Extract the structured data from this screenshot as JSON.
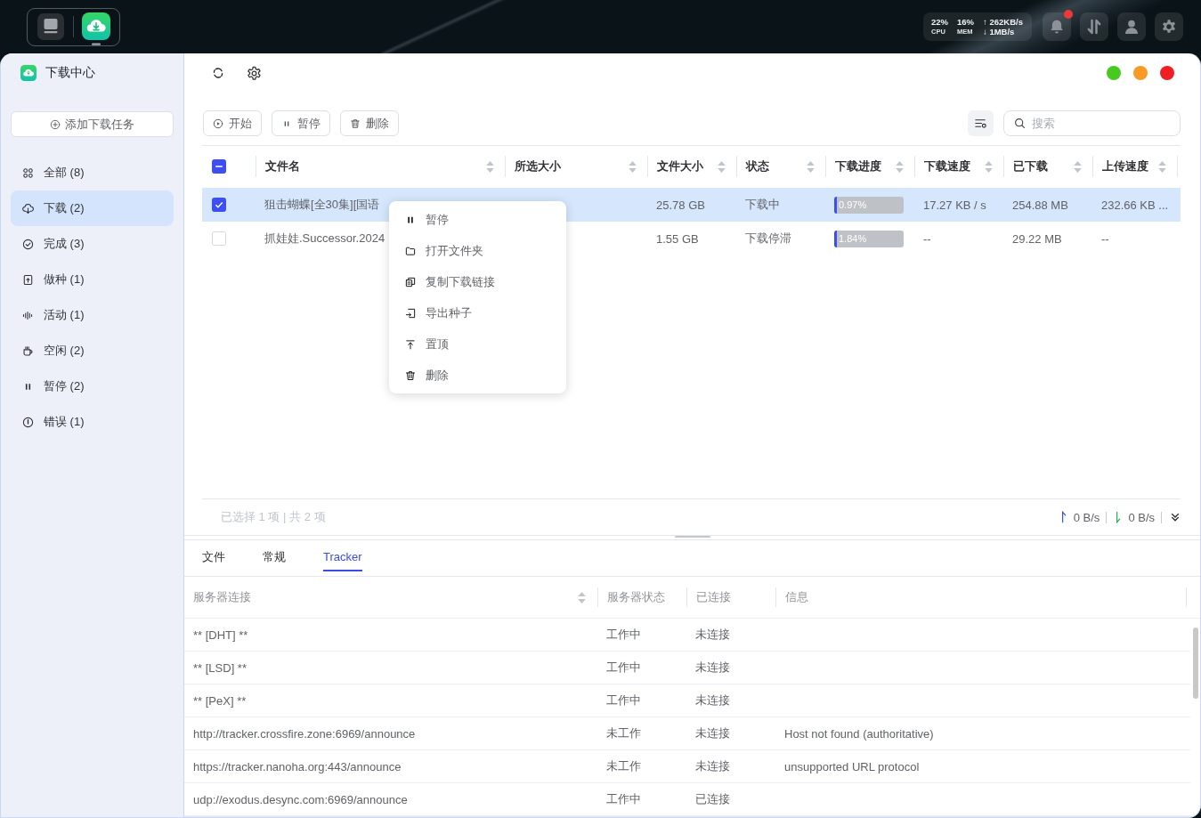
{
  "top_bar": {
    "stats": [
      {
        "value": "22%",
        "label": "CPU"
      },
      {
        "value": "16%",
        "label": "MEM"
      }
    ],
    "upload_rate": "↑ 262KB/s",
    "download_rate": "↓ 1MB/s",
    "notifications": {
      "unread": true
    }
  },
  "sidebar": {
    "title": "下载中心",
    "add_button": "添加下载任务",
    "items": [
      {
        "label": "全部 (8)",
        "selected": false
      },
      {
        "label": "下载 (2)",
        "selected": true
      },
      {
        "label": "完成 (3)",
        "selected": false
      },
      {
        "label": "做种 (1)",
        "selected": false
      },
      {
        "label": "活动 (1)",
        "selected": false
      },
      {
        "label": "空闲 (2)",
        "selected": false
      },
      {
        "label": "暂停 (2)",
        "selected": false
      },
      {
        "label": "错误 (1)",
        "selected": false
      }
    ]
  },
  "toolbar": {
    "actions": [
      "开始",
      "暂停",
      "删除"
    ],
    "search": {
      "placeholder": "搜索"
    }
  },
  "table": {
    "select_all": {
      "checked": false,
      "indeterminate": true
    },
    "columns": [
      "文件名",
      "所选大小",
      "文件大小",
      "状态",
      "下载进度",
      "下载速度",
      "已下载",
      "上传速度"
    ],
    "rows": [
      {
        "selected": true,
        "name": "狙击蝴蝶[全30集][国语",
        "size": "25.78 GB",
        "status": "下载中",
        "level": 0.0097,
        "progress": "0.97%",
        "speed": "17.27 KB / s",
        "downloaded": "254.88 MB",
        "upload_speed": "232.66 KB ..."
      },
      {
        "selected": false,
        "name": "抓娃娃.Successor.2024",
        "size": "1.55 GB",
        "status": "下载停滞",
        "level": 0.0184,
        "progress": "1.84%",
        "speed": "--",
        "downloaded": "29.22 MB",
        "upload_speed": "--"
      }
    ]
  },
  "context_menu": {
    "items": [
      "暂停",
      "打开文件夹",
      "复制下载链接",
      "导出种子",
      "置顶",
      "删除"
    ]
  },
  "footer": {
    "selection": "已选择 1 项 | 共 2 项",
    "upload_rate": "0 B/s",
    "download_rate": "0 B/s"
  },
  "detail_tabs": [
    {
      "label": "文件",
      "selected": false
    },
    {
      "label": "常规",
      "selected": false
    },
    {
      "label": "Tracker",
      "selected": true
    }
  ],
  "trackers": {
    "columns": [
      "服务器连接",
      "服务器状态",
      "已连接",
      "信息"
    ],
    "rows": [
      {
        "url": "** [DHT] **",
        "status": "工作中",
        "connected": "未连接"
      },
      {
        "url": "** [LSD] **",
        "status": "工作中",
        "connected": "未连接"
      },
      {
        "url": "** [PeX] **",
        "status": "工作中",
        "connected": "未连接"
      },
      {
        "url": "http://tracker.crossfire.zone:6969/announce",
        "status": "未工作",
        "connected": "未连接",
        "message": "Host not found (authoritative)"
      },
      {
        "url": "https://tracker.nanoha.org:443/announce",
        "status": "未工作",
        "connected": "未连接",
        "message": "unsupported URL protocol"
      },
      {
        "url": "udp://exodus.desync.com:6969/announce",
        "status": "工作中",
        "connected": "已连接"
      }
    ]
  }
}
